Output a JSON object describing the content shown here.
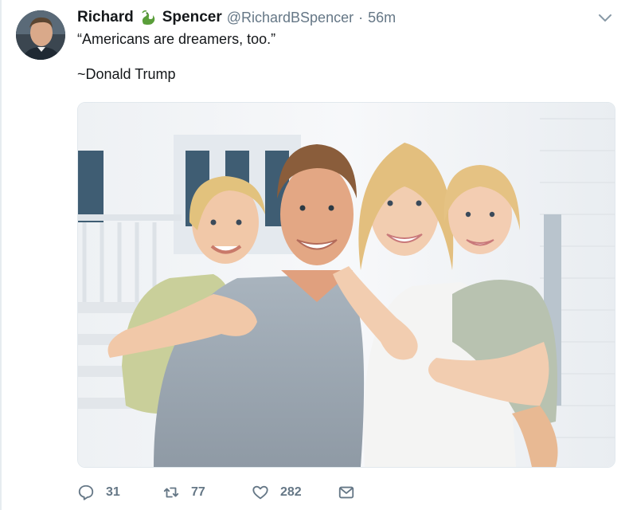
{
  "tweet": {
    "author_first": "Richard",
    "author_emoji": "dragon-emoji",
    "author_last": "Spencer",
    "handle": "@RichardBSpencer",
    "separator": "·",
    "time": "56m",
    "text_lines": [
      "“Americans are dreamers, too.”",
      "",
      "~Donald Trump"
    ],
    "media": {
      "icon": "photo-of-smiling-family"
    }
  },
  "actions": {
    "reply": {
      "icon": "reply-icon",
      "count": "31"
    },
    "retweet": {
      "icon": "retweet-icon",
      "count": "77"
    },
    "like": {
      "icon": "heart-icon",
      "count": "282"
    },
    "dm": {
      "icon": "envelope-icon"
    }
  },
  "colors": {
    "text": "#14171a",
    "muted": "#657786",
    "border": "#e1e8ed",
    "emoji_green": "#5a9e3a"
  }
}
